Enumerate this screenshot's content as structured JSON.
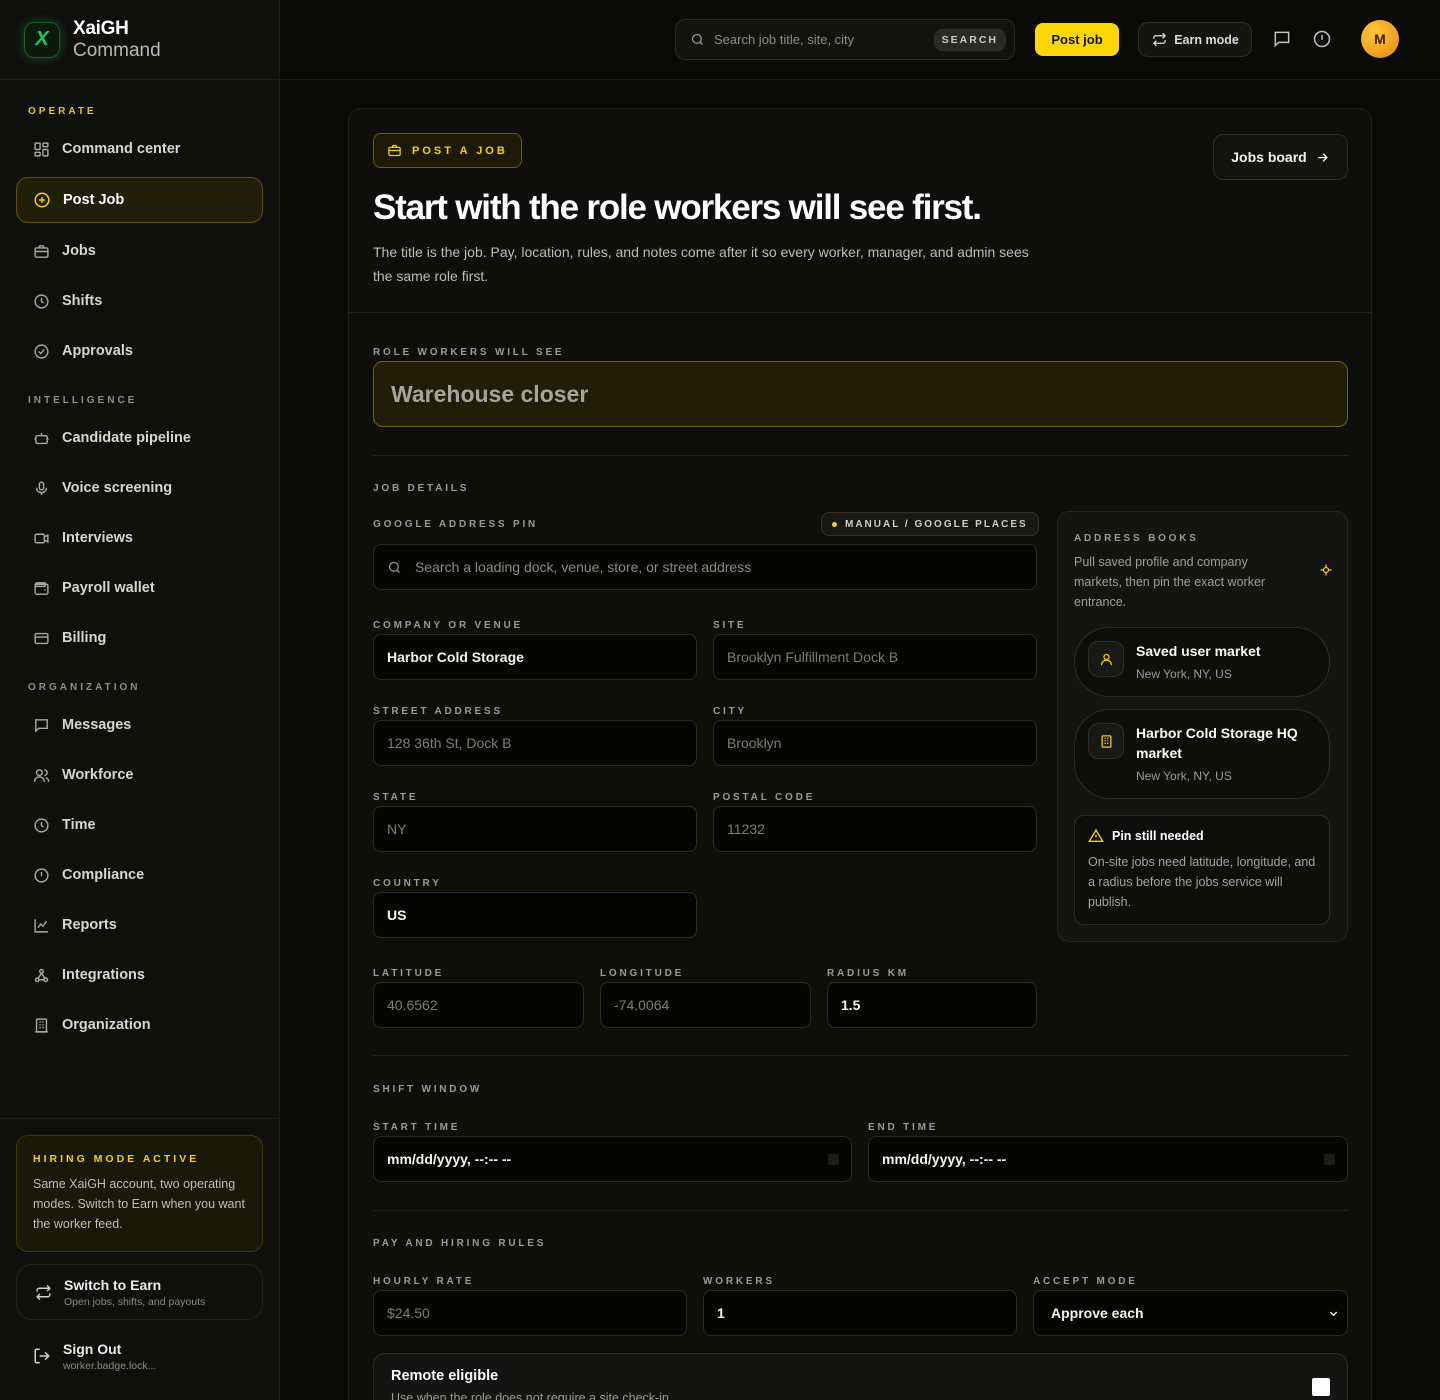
{
  "brand": {
    "name": "XaiGH",
    "sub": "Command",
    "logo": "X"
  },
  "nav": {
    "section_operate": "OPERATE",
    "section_intelligence": "INTELLIGENCE",
    "section_organization": "ORGANIZATION",
    "items": [
      {
        "label": "Command center",
        "icon": "grid-icon"
      },
      {
        "label": "Post Job",
        "icon": "plus-circle-icon"
      },
      {
        "label": "Jobs",
        "icon": "briefcase-icon"
      },
      {
        "label": "Shifts",
        "icon": "clock-icon"
      },
      {
        "label": "Approvals",
        "icon": "check-circle-icon"
      },
      {
        "label": "Candidate pipeline",
        "icon": "bot-icon"
      },
      {
        "label": "Voice screening",
        "icon": "mic-icon"
      },
      {
        "label": "Interviews",
        "icon": "video-icon"
      },
      {
        "label": "Payroll wallet",
        "icon": "wallet-icon"
      },
      {
        "label": "Billing",
        "icon": "card-icon"
      },
      {
        "label": "Messages",
        "icon": "message-icon"
      },
      {
        "label": "Workforce",
        "icon": "users-icon"
      },
      {
        "label": "Time",
        "icon": "clock-icon"
      },
      {
        "label": "Compliance",
        "icon": "alert-circle-icon"
      },
      {
        "label": "Reports",
        "icon": "chart-icon"
      },
      {
        "label": "Integrations",
        "icon": "webhook-icon"
      },
      {
        "label": "Organization",
        "icon": "building-icon"
      }
    ],
    "hiring_title": "HIRING MODE ACTIVE",
    "hiring_text": "Same XaiGH account, two operating modes. Switch to Earn when you want the worker feed.",
    "switch_title": "Switch to Earn",
    "switch_sub": "Open jobs, shifts, and payouts",
    "signout_title": "Sign Out",
    "signout_sub": "worker.badge.lock..."
  },
  "topbar": {
    "search_placeholder": "Search job title, site, city",
    "search_button": "SEARCH",
    "post_job": "Post job",
    "earn_mode": "Earn mode",
    "avatar": "M"
  },
  "page": {
    "chip": "POST A JOB",
    "jobs_board": "Jobs board",
    "title": "Start with the role workers will see first.",
    "lead": "The title is the job. Pay, location, rules, and notes come after it so every worker, manager, and admin sees the same role first.",
    "role_label": "ROLE WORKERS WILL SEE",
    "role_placeholder": "Warehouse closer",
    "job_details": "JOB DETAILS",
    "address_pin_label": "GOOGLE ADDRESS PIN",
    "manual_chip": "MANUAL / GOOGLE PLACES",
    "address_placeholder": "Search a loading dock, venue, store, or street address",
    "company_label": "COMPANY OR VENUE",
    "company_value": "Harbor Cold Storage",
    "site_label": "SITE",
    "site_placeholder": "Brooklyn Fulfillment Dock B",
    "street_label": "STREET ADDRESS",
    "street_placeholder": "128 36th St, Dock B",
    "city_label": "CITY",
    "city_placeholder": "Brooklyn",
    "state_label": "STATE",
    "state_placeholder": "NY",
    "postal_label": "POSTAL CODE",
    "postal_placeholder": "11232",
    "country_label": "COUNTRY",
    "country_value": "US",
    "lat_label": "LATITUDE",
    "lat_placeholder": "40.6562",
    "lng_label": "LONGITUDE",
    "lng_placeholder": "-74.0064",
    "radius_label": "RADIUS KM",
    "radius_value": "1.5",
    "shift_window": "SHIFT WINDOW",
    "start_label": "START TIME",
    "start_value": "mm/dd/yyyy, --:-- --",
    "end_label": "END TIME",
    "end_value": "mm/dd/yyyy, --:-- --",
    "pay_rules": "PAY AND HIRING RULES",
    "rate_label": "HOURLY RATE",
    "rate_placeholder": "$24.50",
    "workers_label": "WORKERS",
    "workers_value": "1",
    "accept_label": "ACCEPT MODE",
    "accept_value": "Approve each",
    "remote_title": "Remote eligible",
    "remote_sub": "Use when the role does not require a site check-in."
  },
  "address_books": {
    "title": "ADDRESS BOOKS",
    "text": "Pull saved profile and company markets, then pin the exact worker entrance.",
    "market1_title": "Saved user market",
    "market1_sub": "New York, NY, US",
    "market2_title": "Harbor Cold Storage HQ market",
    "market2_sub": "New York, NY, US",
    "pin_title": "Pin still needed",
    "pin_text": "On-site jobs need latitude, longitude, and a radius before the jobs service will publish."
  },
  "colors": {
    "accent": "#ffd60a",
    "brand_green": "#22c55e",
    "background": "#0a0a08"
  }
}
